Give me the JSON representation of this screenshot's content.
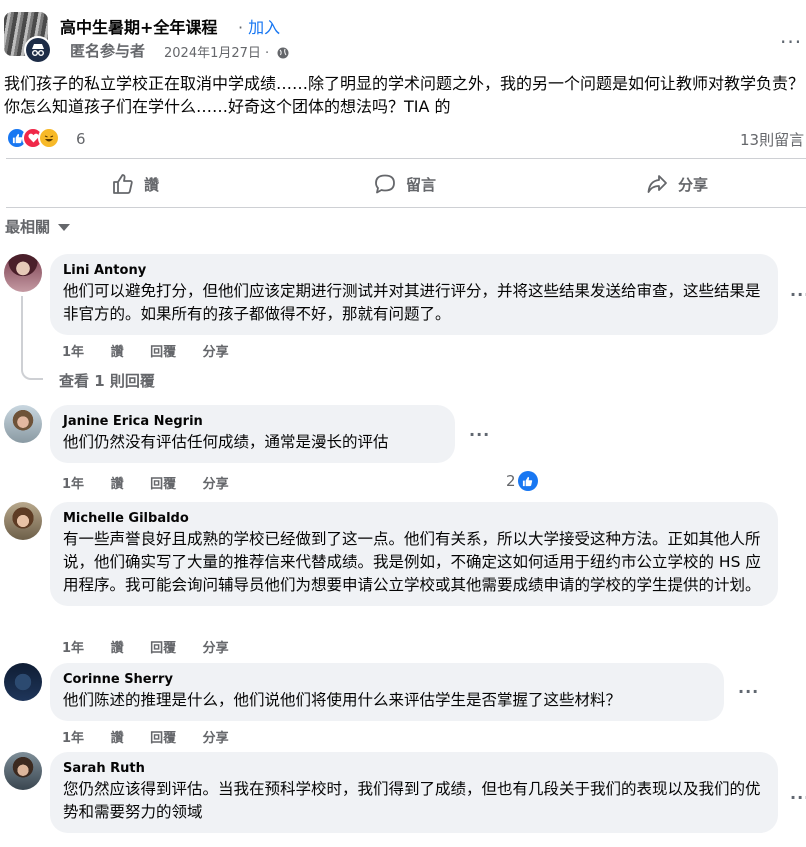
{
  "group": {
    "name": "高中生暑期+全年课程",
    "join_label": "加入",
    "author": "匿名参与者",
    "date": "2024年1月27日",
    "more": "···"
  },
  "post": {
    "text": "我们孩子的私立学校正在取消中学成绩……除了明显的学术问题之外，我的另一个问题是如何让教师对教学负责？你怎么知道孩子们在学什么……好奇这个团体的想法吗？TIA 的",
    "reaction_count": "6",
    "comment_count": "13則留言",
    "reactions": [
      "like-icon",
      "love-icon",
      "haha-icon"
    ]
  },
  "actions": {
    "like": "讚",
    "comment": "留言",
    "share": "分享"
  },
  "sort_label": "最相關",
  "comment_actions": {
    "like": "讚",
    "reply": "回覆",
    "share": "分享"
  },
  "comments": [
    {
      "name": "Lini Antony",
      "text": "他们可以避免打分，但他们应该定期进行测试并对其进行评分，并将这些结果发送给审查，这些结果是非官方的。如果所有的孩子都做得不好，那就有问题了。",
      "time": "1年",
      "view_replies": "查看 1 則回覆"
    },
    {
      "name": "Janine Erica Negrin",
      "text": "他们仍然没有评估任何成绩，通常是漫长的评估",
      "time": "1年",
      "likes": "2"
    },
    {
      "name": "Michelle Gilbaldo",
      "text": "有一些声誉良好且成熟的学校已经做到了这一点。他们有关系，所以大学接受这种方法。正如其他人所说，他们确实写了大量的推荐信来代替成绩。我是例如，不确定这如何适用于纽约市公立学校的 HS 应用程序。我可能会询问辅导员他们为想要申请公立学校或其他需要成绩申请的学校的学生提供的计划。",
      "time": "1年"
    },
    {
      "name": "Corinne Sherry",
      "text": "他们陈述的推理是什么，他们说他们将使用什么来评估学生是否掌握了这些材料？",
      "time": "1年"
    },
    {
      "name": "Sarah Ruth",
      "text": "您仍然应该得到评估。当我在预科学校时，我们得到了成绩，但也有几段关于我们的表现以及我们的优势和需要努力的领域",
      "time": "1年"
    }
  ],
  "colors": {
    "accent": "#1877f2",
    "secondary_text": "#65676b",
    "bubble": "#f0f2f5",
    "love": "#f02849",
    "haha": "#f7b928"
  }
}
